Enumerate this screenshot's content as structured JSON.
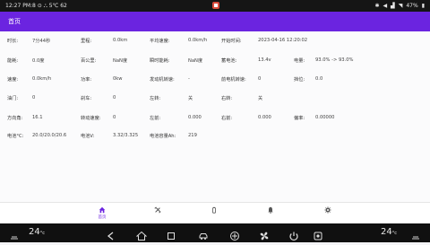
{
  "status_bar": {
    "left_text": "12:27  PM:8 ⊙ ⛬ 5℃ 62",
    "right_text": "47%"
  },
  "title_bar": {
    "title": "首页"
  },
  "rows": [
    [
      [
        "时长:",
        "label"
      ],
      [
        "7分44秒",
        "value"
      ],
      [
        "里程:",
        "label"
      ],
      [
        "0.0km",
        "value"
      ],
      [
        "平均速度:",
        "label"
      ],
      [
        "0.0km/h",
        "value"
      ],
      [
        "开始时间:",
        "label"
      ],
      [
        "2023-04-16 12:20:02",
        "value"
      ]
    ],
    [
      [
        "能耗:",
        "label"
      ],
      [
        "0.0度",
        "value"
      ],
      [
        "百公里:",
        "label"
      ],
      [
        "NaN度",
        "value"
      ],
      [
        "瞬时能耗:",
        "label"
      ],
      [
        "NaN度",
        "value"
      ],
      [
        "蓄电池:",
        "label"
      ],
      [
        "13.4v",
        "value"
      ],
      [
        "电量:",
        "label"
      ],
      [
        "93.0% -> 93.0%",
        "value"
      ]
    ],
    [
      [
        "速度:",
        "label"
      ],
      [
        "0.0km/h",
        "value"
      ],
      [
        "功率:",
        "label"
      ],
      [
        "0kw",
        "value"
      ],
      [
        "发动机转速:",
        "label"
      ],
      [
        "-",
        "value"
      ],
      [
        "前电机转速:",
        "label"
      ],
      [
        "0",
        "value"
      ],
      [
        "挡位:",
        "label"
      ],
      [
        "0.0",
        "value"
      ]
    ],
    [
      [
        "油门:",
        "label"
      ],
      [
        "0",
        "value"
      ],
      [
        "刹车:",
        "label"
      ],
      [
        "0",
        "value"
      ],
      [
        "左转:",
        "label"
      ],
      [
        "关",
        "value"
      ],
      [
        "右转:",
        "label"
      ],
      [
        "关",
        "value"
      ]
    ],
    [
      [
        "方向角:",
        "label"
      ],
      [
        "16.1",
        "value"
      ],
      [
        "转动速度:",
        "label"
      ],
      [
        "0",
        "value"
      ],
      [
        "左前:",
        "label"
      ],
      [
        "0.000",
        "value"
      ],
      [
        "右前:",
        "label"
      ],
      [
        "0.000",
        "value"
      ],
      [
        "偏率:",
        "label"
      ],
      [
        "0.00000",
        "value"
      ]
    ],
    [
      [
        "电池°C:",
        "label"
      ],
      [
        "20.0/20.0/20.6",
        "value"
      ],
      [
        "电池V:",
        "label"
      ],
      [
        "3.32/3.325",
        "value"
      ],
      [
        "电池容量Ah:",
        "label"
      ],
      [
        "219",
        "value"
      ]
    ]
  ],
  "nav": {
    "items": [
      {
        "icon": "home-icon",
        "label": "首页"
      },
      {
        "icon": "tools-icon",
        "label": ""
      },
      {
        "icon": "battery-icon",
        "label": ""
      },
      {
        "icon": "bell-icon",
        "label": ""
      },
      {
        "icon": "gear-icon",
        "label": ""
      }
    ]
  },
  "system_bar": {
    "left_temp": "24",
    "right_temp": "24",
    "unit": "°c"
  }
}
